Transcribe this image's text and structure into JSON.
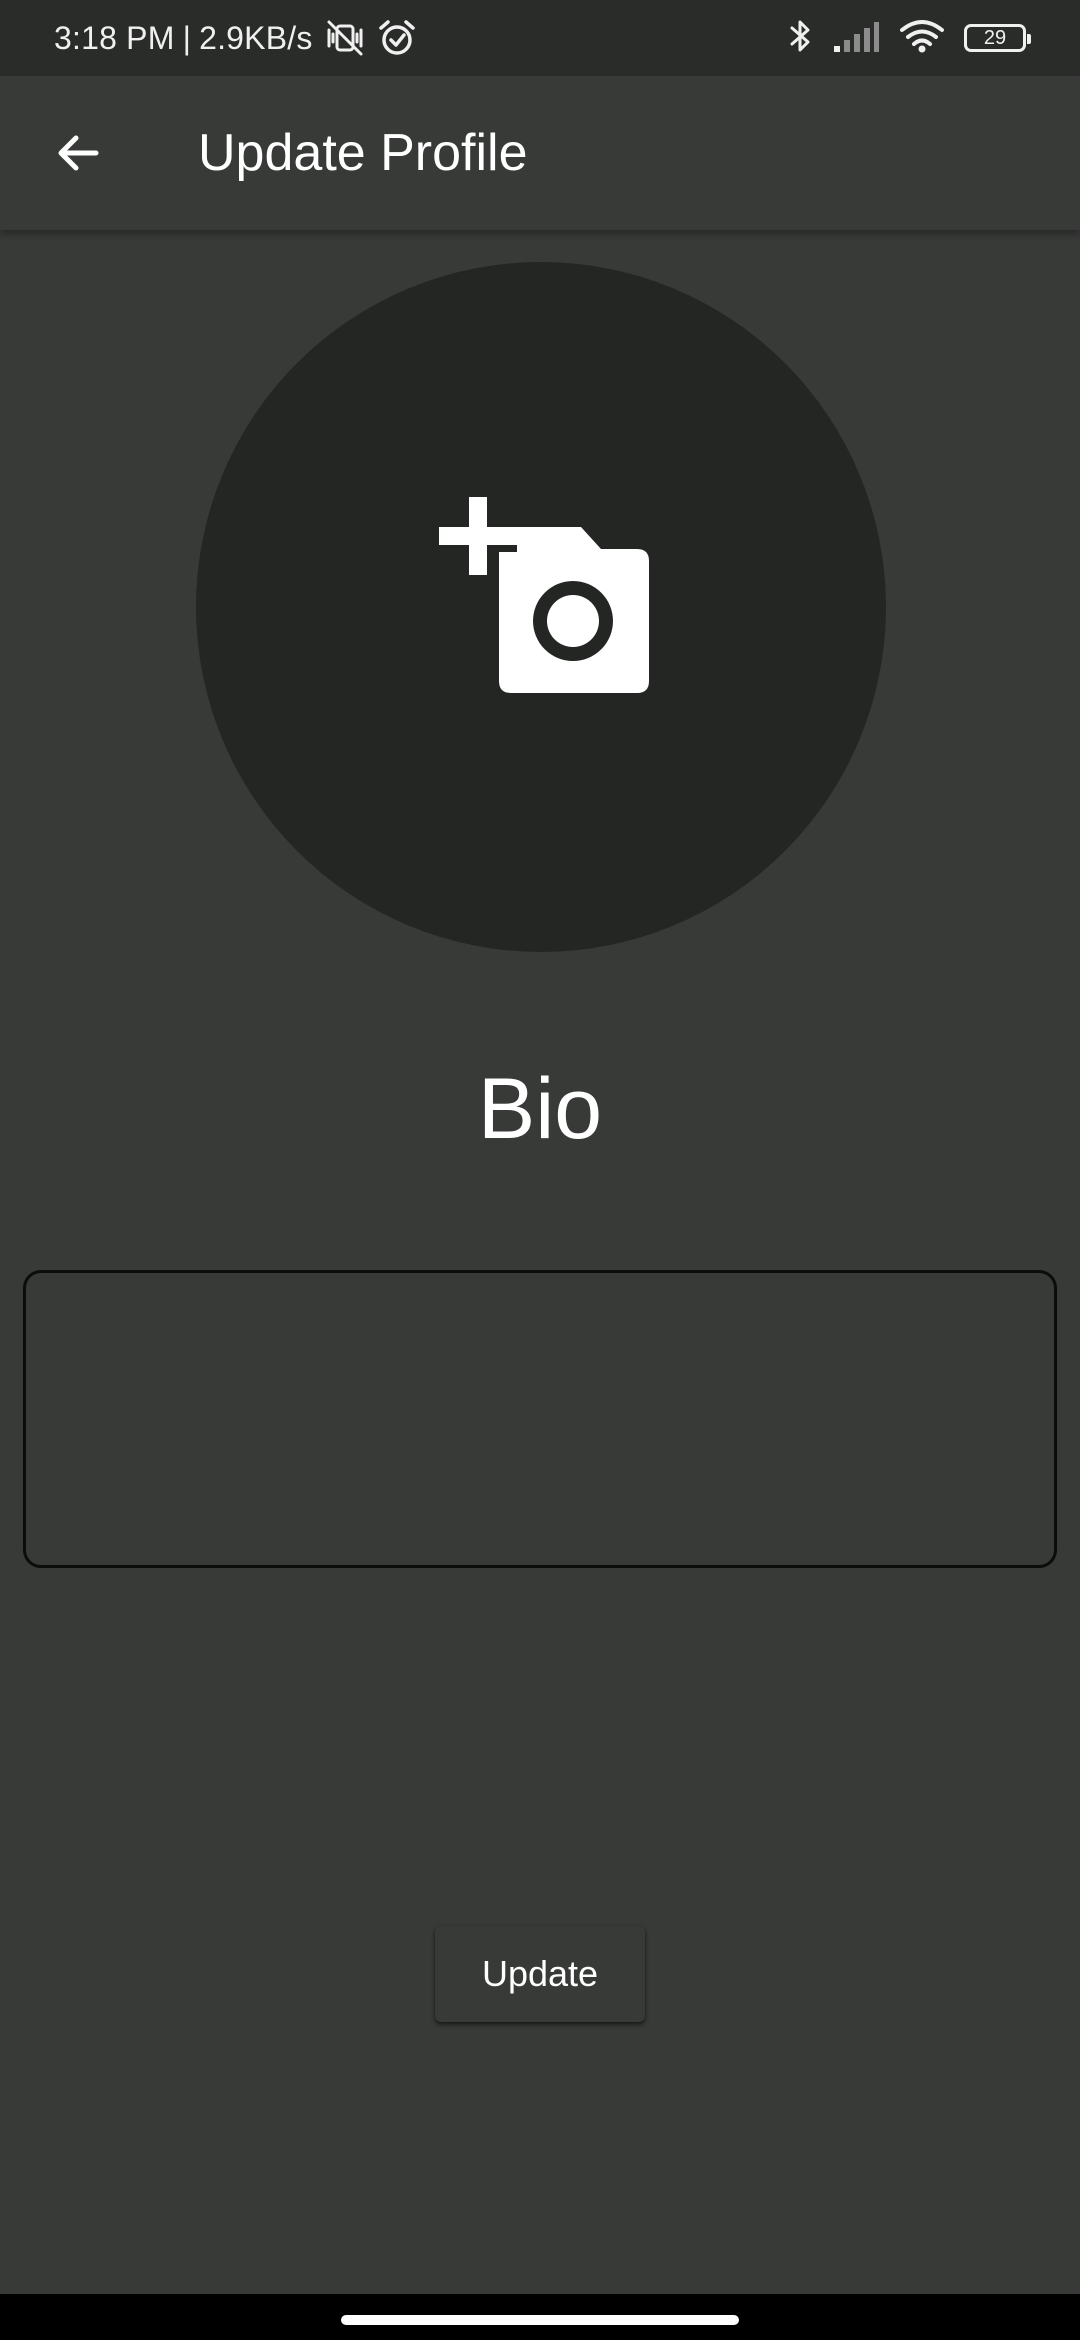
{
  "status_bar": {
    "time": "3:18 PM",
    "separator": "|",
    "network_speed": "2.9KB/s",
    "battery_level": "29",
    "icons": [
      "muted-vibrate-icon",
      "alarm-icon",
      "bluetooth-icon",
      "signal-icon",
      "wifi-icon",
      "battery-icon"
    ]
  },
  "app_bar": {
    "title": "Update Profile",
    "back_icon": "arrow-back-icon"
  },
  "avatar": {
    "icon": "add-a-photo-icon"
  },
  "bio": {
    "label": "Bio",
    "value": ""
  },
  "actions": {
    "update_label": "Update"
  },
  "colors": {
    "background": "#383a38",
    "status_bar": "#2a2c2a",
    "avatar_circle": "#242624",
    "text": "#ffffff"
  }
}
